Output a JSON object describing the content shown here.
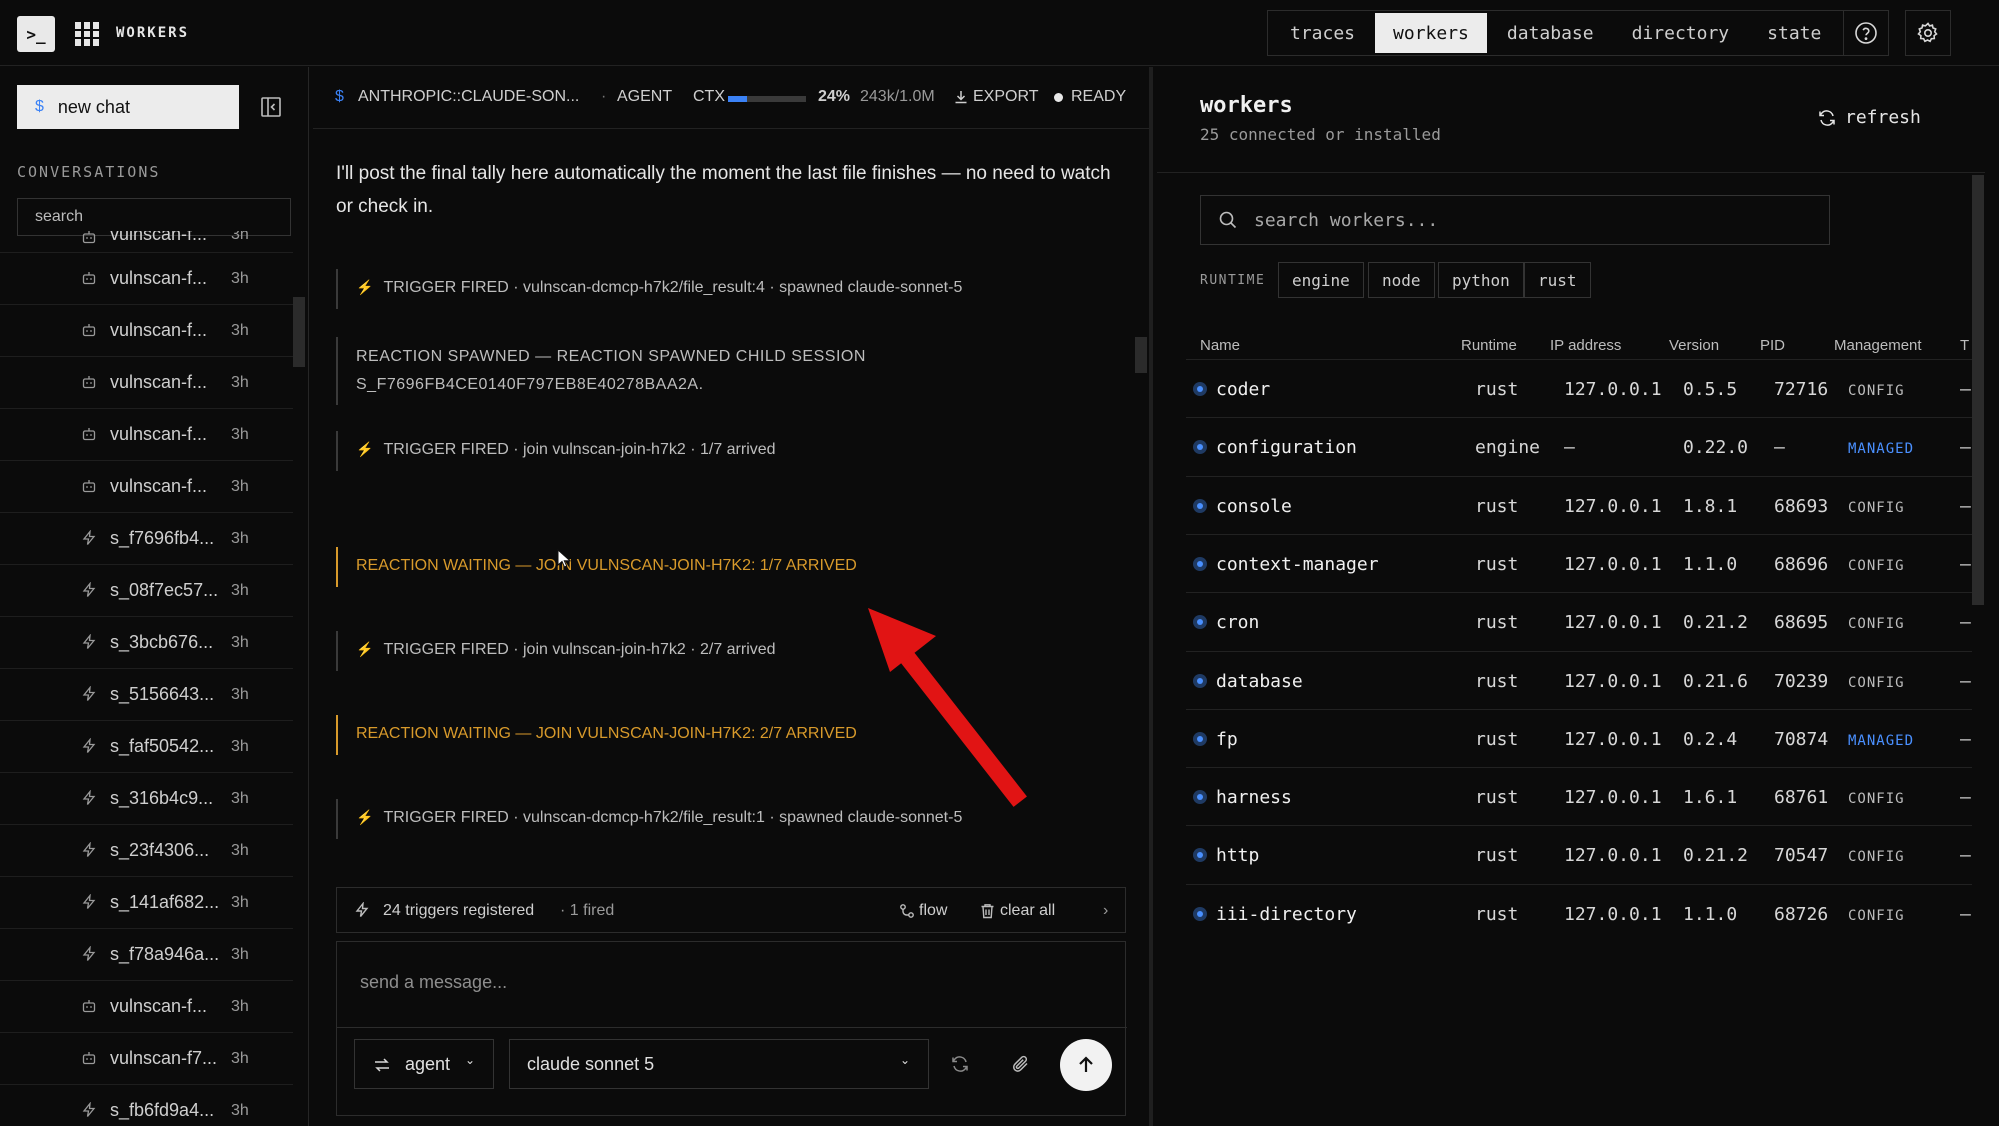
{
  "topbar": {
    "terminal_glyph": ">_",
    "app_title": "WORKERS",
    "tabs": [
      {
        "label": "traces",
        "active": false
      },
      {
        "label": "workers",
        "active": true
      },
      {
        "label": "database",
        "active": false
      },
      {
        "label": "directory",
        "active": false
      },
      {
        "label": "state",
        "active": false
      }
    ],
    "icons": [
      "help-icon",
      "gear-icon"
    ]
  },
  "sidebar": {
    "new_chat_icon": "$",
    "new_chat_label": "new chat",
    "conversations_label": "CONVERSATIONS",
    "search_placeholder": "search",
    "items": [
      {
        "icon": "bot-icon",
        "name": "vulnscan-f...",
        "time": "3h"
      },
      {
        "icon": "bot-icon",
        "name": "vulnscan-f...",
        "time": "3h"
      },
      {
        "icon": "bot-icon",
        "name": "vulnscan-f...",
        "time": "3h"
      },
      {
        "icon": "bot-icon",
        "name": "vulnscan-f...",
        "time": "3h"
      },
      {
        "icon": "bot-icon",
        "name": "vulnscan-f...",
        "time": "3h"
      },
      {
        "icon": "bolt-icon",
        "name": "s_f7696fb4...",
        "time": "3h"
      },
      {
        "icon": "bolt-icon",
        "name": "s_08f7ec57...",
        "time": "3h"
      },
      {
        "icon": "bolt-icon",
        "name": "s_3bcb676...",
        "time": "3h"
      },
      {
        "icon": "bolt-icon",
        "name": "s_5156643...",
        "time": "3h"
      },
      {
        "icon": "bolt-icon",
        "name": "s_faf50542...",
        "time": "3h"
      },
      {
        "icon": "bolt-icon",
        "name": "s_316b4c9...",
        "time": "3h"
      },
      {
        "icon": "bolt-icon",
        "name": "s_23f4306...",
        "time": "3h"
      },
      {
        "icon": "bolt-icon",
        "name": "s_141af682...",
        "time": "3h"
      },
      {
        "icon": "bolt-icon",
        "name": "s_f78a946a...",
        "time": "3h"
      },
      {
        "icon": "bot-icon",
        "name": "vulnscan-f...",
        "time": "3h"
      },
      {
        "icon": "bot-icon",
        "name": "vulnscan-f7...",
        "time": "3h"
      },
      {
        "icon": "bolt-icon",
        "name": "s_fb6fd9a4...",
        "time": "3h"
      }
    ]
  },
  "chat": {
    "header": {
      "model": "ANTHROPIC::CLAUDE-SON...",
      "sep": "·",
      "mode": "AGENT",
      "ctx_label": "CTX",
      "ctx_fraction": 0.24,
      "ctx_percent": "24%",
      "ctx_tokens": "243k/1.0M",
      "export_label": "EXPORT",
      "status": "READY"
    },
    "message": "I'll post the final tally here automatically the moment the last file finishes — no need to watch or check in.",
    "events": [
      {
        "kind": "trigger",
        "text": "TRIGGER FIRED · vulnscan-dcmcp-h7k2/file_result:4 · spawned claude-sonnet-5"
      },
      {
        "kind": "reaction",
        "text": "REACTION SPAWNED — REACTION SPAWNED CHILD SESSION S_F7696FB4CE0140F797EB8E40278BAA2A."
      },
      {
        "kind": "trigger",
        "text": "TRIGGER FIRED · join vulnscan-join-h7k2 · 1/7 arrived"
      },
      {
        "kind": "waiting",
        "text": "REACTION WAITING — JOIN VULNSCAN-JOIN-H7K2: 1/7 ARRIVED"
      },
      {
        "kind": "trigger",
        "text": "TRIGGER FIRED · join vulnscan-join-h7k2 · 2/7 arrived"
      },
      {
        "kind": "waiting",
        "text": "REACTION WAITING — JOIN VULNSCAN-JOIN-H7K2: 2/7 ARRIVED"
      },
      {
        "kind": "trigger",
        "text": "TRIGGER FIRED · vulnscan-dcmcp-h7k2/file_result:1 · spawned claude-sonnet-5"
      }
    ],
    "triggers": {
      "registered": "24 triggers registered",
      "fired": "· 1 fired",
      "flow_label": "flow",
      "clear_label": "clear all"
    },
    "composer": {
      "placeholder": "send a message...",
      "mode_label": "agent",
      "model_label": "claude sonnet 5"
    }
  },
  "workers": {
    "title": "workers",
    "subtitle": "25 connected or installed",
    "refresh_label": "refresh",
    "search_placeholder": "search workers...",
    "runtime_label": "RUNTIME",
    "runtime_filters": [
      "engine",
      "node",
      "python",
      "rust"
    ],
    "columns": [
      "Name",
      "Runtime",
      "IP address",
      "Version",
      "PID",
      "Management",
      "T"
    ],
    "rows": [
      {
        "name": "coder",
        "runtime": "rust",
        "ip": "127.0.0.1",
        "version": "0.5.5",
        "pid": "72716",
        "management": "CONFIG",
        "managed": false,
        "extra": "–"
      },
      {
        "name": "configuration",
        "runtime": "engine",
        "ip": "–",
        "version": "0.22.0",
        "pid": "–",
        "management": "MANAGED",
        "managed": true,
        "extra": "–"
      },
      {
        "name": "console",
        "runtime": "rust",
        "ip": "127.0.0.1",
        "version": "1.8.1",
        "pid": "68693",
        "management": "CONFIG",
        "managed": false,
        "extra": "–"
      },
      {
        "name": "context-manager",
        "runtime": "rust",
        "ip": "127.0.0.1",
        "version": "1.1.0",
        "pid": "68696",
        "management": "CONFIG",
        "managed": false,
        "extra": "–"
      },
      {
        "name": "cron",
        "runtime": "rust",
        "ip": "127.0.0.1",
        "version": "0.21.2",
        "pid": "68695",
        "management": "CONFIG",
        "managed": false,
        "extra": "–"
      },
      {
        "name": "database",
        "runtime": "rust",
        "ip": "127.0.0.1",
        "version": "0.21.6",
        "pid": "70239",
        "management": "CONFIG",
        "managed": false,
        "extra": "–"
      },
      {
        "name": "fp",
        "runtime": "rust",
        "ip": "127.0.0.1",
        "version": "0.2.4",
        "pid": "70874",
        "management": "MANAGED",
        "managed": true,
        "extra": "–"
      },
      {
        "name": "harness",
        "runtime": "rust",
        "ip": "127.0.0.1",
        "version": "1.6.1",
        "pid": "68761",
        "management": "CONFIG",
        "managed": false,
        "extra": "–"
      },
      {
        "name": "http",
        "runtime": "rust",
        "ip": "127.0.0.1",
        "version": "0.21.2",
        "pid": "70547",
        "management": "CONFIG",
        "managed": false,
        "extra": "–"
      },
      {
        "name": "iii-directory",
        "runtime": "rust",
        "ip": "127.0.0.1",
        "version": "1.1.0",
        "pid": "68726",
        "management": "CONFIG",
        "managed": false,
        "extra": "–"
      }
    ]
  },
  "colors": {
    "background": "#0b0b0b",
    "accent": "#3b82f6",
    "managed": "#4a90ff",
    "warning": "#d89a2b",
    "bolt": "#f5c518",
    "annotation": "#e11414"
  }
}
